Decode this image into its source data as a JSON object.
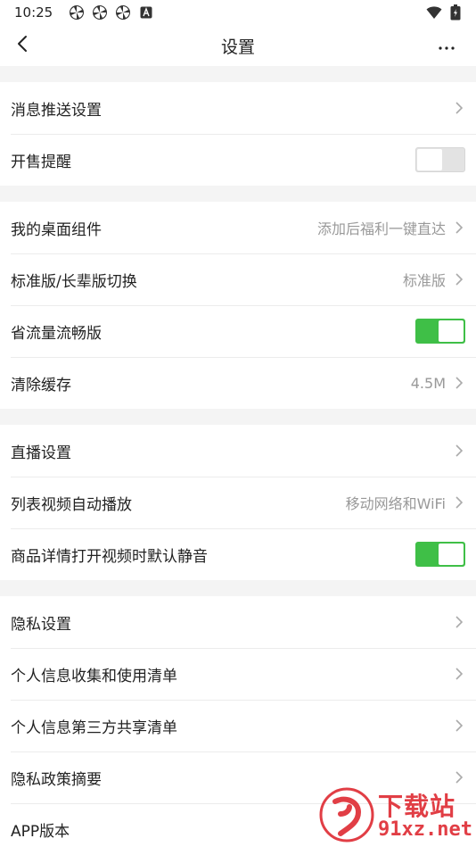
{
  "status_bar": {
    "time": "10:25",
    "notification_icons": [
      "pinwheel-icon",
      "pinwheel-icon",
      "pinwheel-icon",
      "a-badge-icon"
    ],
    "right_icons": [
      "wifi-icon",
      "battery-icon"
    ]
  },
  "header": {
    "title": "设置",
    "back_icon": "chevron-left-icon",
    "more_icon": "more-dots-icon"
  },
  "sections": [
    {
      "rows": [
        {
          "label": "消息推送设置",
          "type": "link",
          "value": ""
        },
        {
          "label": "开售提醒",
          "type": "toggle",
          "on": false
        }
      ]
    },
    {
      "rows": [
        {
          "label": "我的桌面组件",
          "type": "link",
          "value": "添加后福利一键直达"
        },
        {
          "label": "标准版/长辈版切换",
          "type": "link",
          "value": "标准版"
        },
        {
          "label": "省流量流畅版",
          "type": "toggle",
          "on": true
        },
        {
          "label": "清除缓存",
          "type": "link",
          "value": "4.5M"
        }
      ]
    },
    {
      "rows": [
        {
          "label": "直播设置",
          "type": "link",
          "value": ""
        },
        {
          "label": "列表视频自动播放",
          "type": "link",
          "value": "移动网络和WiFi"
        },
        {
          "label": "商品详情打开视频时默认静音",
          "type": "toggle",
          "on": true
        }
      ]
    },
    {
      "rows": [
        {
          "label": "隐私设置",
          "type": "link",
          "value": ""
        },
        {
          "label": "个人信息收集和使用清单",
          "type": "link",
          "value": ""
        },
        {
          "label": "个人信息第三方共享清单",
          "type": "link",
          "value": ""
        },
        {
          "label": "隐私政策摘要",
          "type": "link",
          "value": ""
        },
        {
          "label": "APP版本",
          "type": "link",
          "value": ""
        }
      ]
    }
  ],
  "watermark": {
    "top": "下载站",
    "bottom": "91xz.net"
  },
  "colors": {
    "toggle_on": "#3fbf47",
    "toggle_off": "#e3e3e3",
    "section_gap": "#f4f4f4",
    "value_text": "#999999",
    "watermark": "#e0343c"
  }
}
